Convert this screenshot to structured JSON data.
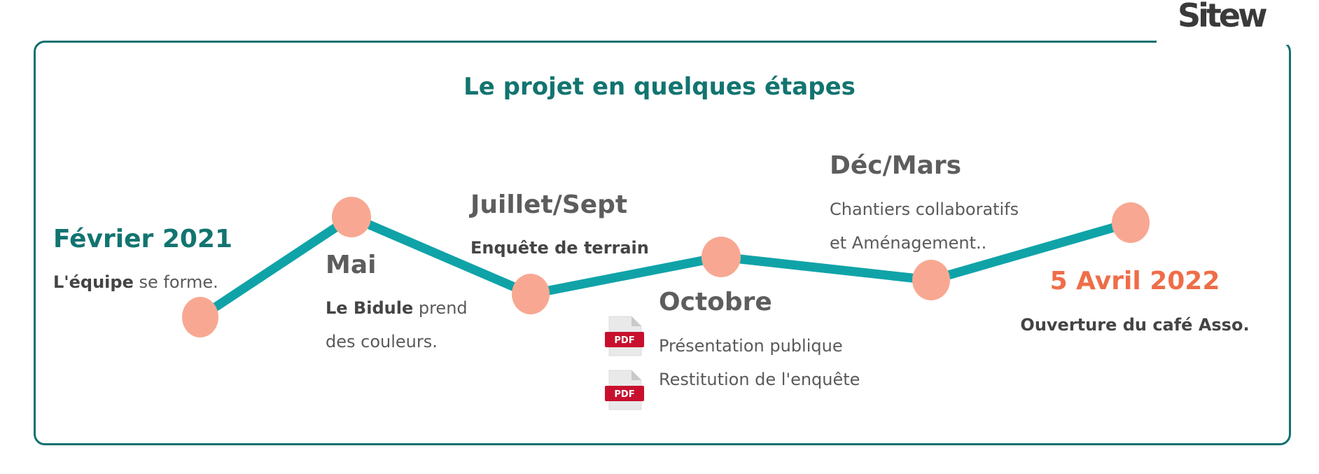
{
  "brand": {
    "logo_text": "Sitew"
  },
  "title": "Le projet en quelques étapes",
  "colors": {
    "teal": "#127470",
    "line": "#0fa3a8",
    "dot": "#f8a892",
    "orange": "#ee6e48",
    "pdf_red": "#c8102e"
  },
  "milestones": [
    {
      "date": "Février 2021",
      "lead": "L'équipe",
      "text": "se forme."
    },
    {
      "date": "Mai",
      "lead": "Le Bidule",
      "text_line1": "prend",
      "text_line2": "des couleurs."
    },
    {
      "date": "Juillet/Sept",
      "lead": "Enquête de terrain"
    },
    {
      "date": "Octobre",
      "links": [
        {
          "icon": "pdf-icon",
          "label": "PDF",
          "text": "Présentation publique"
        },
        {
          "icon": "pdf-icon",
          "label": "PDF",
          "text": "Restitution de l'enquête"
        }
      ]
    },
    {
      "date": "Déc/Mars",
      "text_line1": "Chantiers collaboratifs",
      "text_line2": "et Aménagement.."
    },
    {
      "date": "5 Avril 2022",
      "lead": "Ouverture du café Asso."
    }
  ]
}
